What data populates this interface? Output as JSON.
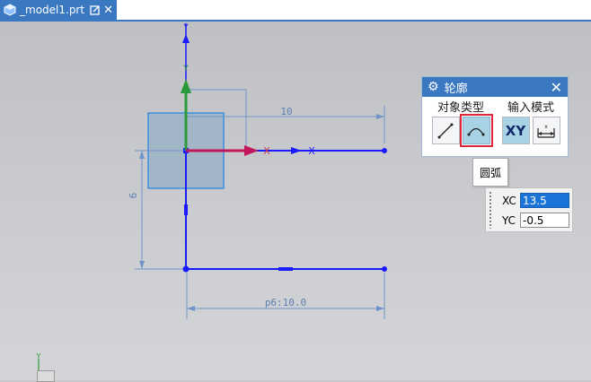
{
  "tab": {
    "filename": "_model1.prt",
    "close_glyph": "✕"
  },
  "canvas": {
    "dim_horizontal_top": "10",
    "dim_vertical": "6",
    "dim_horizontal_bottom": "p6:10.0",
    "axis_y_label": "Y",
    "axis_x_label": "X",
    "corner_axis_label": "Y"
  },
  "dialog": {
    "title": "轮廓",
    "object_type_label": "对象类型",
    "input_mode_label": "输入模式",
    "xy_label": "XY",
    "close_glyph": "✕",
    "gear_glyph": "⚙"
  },
  "tooltip": {
    "text": "圆弧"
  },
  "coords": {
    "xc_label": "XC",
    "xc_value": "13.5",
    "yc_label": "YC",
    "yc_value": "-0.5"
  },
  "colors": {
    "accent": "#3a78c2",
    "sketch": "#1a1aff",
    "highlight": "#e0263a"
  }
}
